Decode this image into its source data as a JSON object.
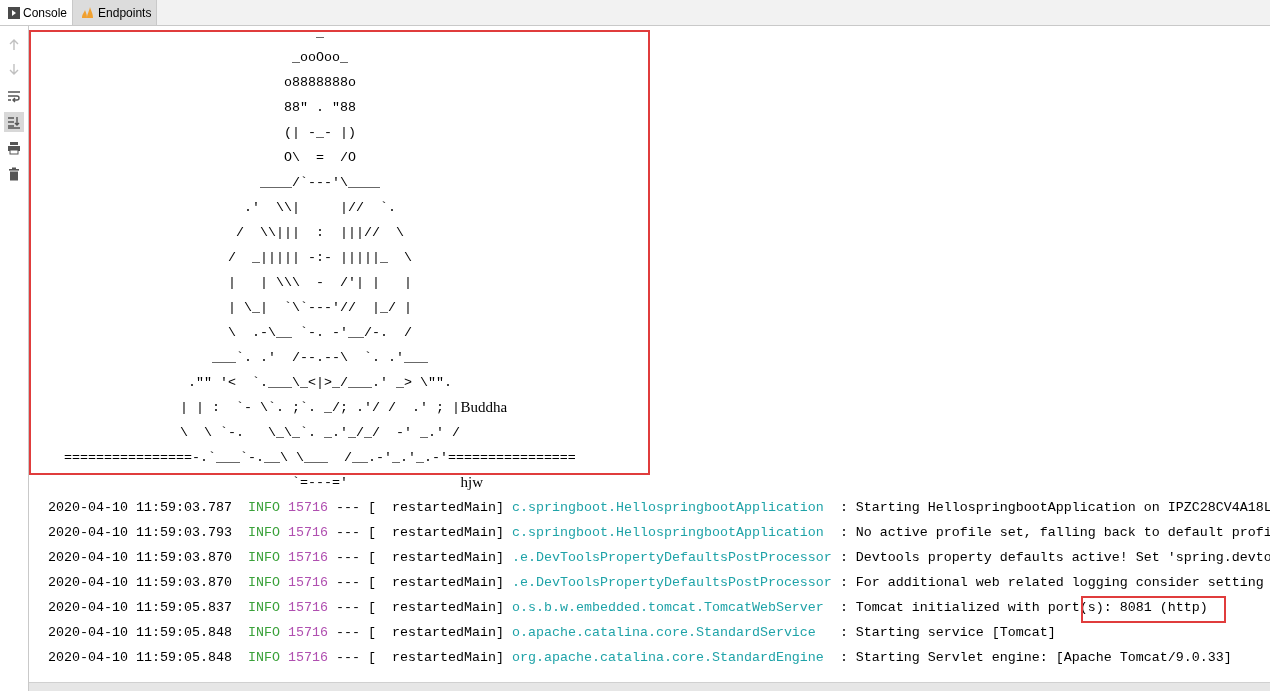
{
  "tabs": [
    {
      "label": "Console",
      "kind": "console",
      "selected": true
    },
    {
      "label": "Endpoints",
      "kind": "endpoints",
      "selected": false
    }
  ],
  "toolbar": [
    {
      "kind": "up",
      "disabled": true,
      "selected": false
    },
    {
      "kind": "down",
      "disabled": true,
      "selected": false
    },
    {
      "kind": "wrap",
      "disabled": false,
      "selected": false
    },
    {
      "kind": "scroll-end",
      "disabled": false,
      "selected": true
    },
    {
      "kind": "print",
      "disabled": false,
      "selected": false
    },
    {
      "kind": "clear",
      "disabled": false,
      "selected": false
    }
  ],
  "banner": [
    {
      "art": "_"
    },
    {
      "art": "_ooOoo_"
    },
    {
      "art": "o8888888o"
    },
    {
      "art": "88\" . \"88"
    },
    {
      "art": "(| -_- |)"
    },
    {
      "art": "O\\  =  /O"
    },
    {
      "art": "____/`---'\\____"
    },
    {
      "art": ".'  \\\\|     |//  `."
    },
    {
      "art": "/  \\\\|||  :  |||//  \\"
    },
    {
      "art": "/  _||||| -:- |||||_  \\"
    },
    {
      "art": "|   | \\\\\\  -  /'| |   |"
    },
    {
      "art": "| \\_|  `\\`---'//  |_/ |"
    },
    {
      "art": "\\  .-\\__ `-. -'__/-.  /"
    },
    {
      "art": "___`. .'  /--.--\\  `. .'___"
    },
    {
      "art": ".\"\" '<  `.___\\_<|>_/___.' _> \\\"\"."
    },
    {
      "art": "| | :  `- \\`. ;`. _/; .'/ /  .' ; |",
      "note": "Buddha"
    },
    {
      "art": "\\  \\ `-.   \\_\\_`. _.'_/_/  -' _.' /"
    },
    {
      "art": "================-.`___`-.__\\ \\___  /__.-'_.'_.-'================"
    },
    {
      "art": "`=---='",
      "note": "hjw"
    }
  ],
  "log": [
    {
      "time": "2020-04-10 11:59:03.787",
      "level": "INFO",
      "pid": "15716",
      "thread": "--- [  restartedMain]",
      "logger": "c.springboot.HellospringbootApplication",
      "message": ": Starting HellospringbootApplication on IPZC28CV4A18L"
    },
    {
      "time": "2020-04-10 11:59:03.793",
      "level": "INFO",
      "pid": "15716",
      "thread": "--- [  restartedMain]",
      "logger": "c.springboot.HellospringbootApplication",
      "message": ": No active profile set, falling back to default profi"
    },
    {
      "time": "2020-04-10 11:59:03.870",
      "level": "INFO",
      "pid": "15716",
      "thread": "--- [  restartedMain]",
      "logger": ".e.DevToolsPropertyDefaultsPostProcessor",
      "message": ": Devtools property defaults active! Set 'spring.devto"
    },
    {
      "time": "2020-04-10 11:59:03.870",
      "level": "INFO",
      "pid": "15716",
      "thread": "--- [  restartedMain]",
      "logger": ".e.DevToolsPropertyDefaultsPostProcessor",
      "message": ": For additional web related logging consider setting"
    },
    {
      "time": "2020-04-10 11:59:05.837",
      "level": "INFO",
      "pid": "15716",
      "thread": "--- [  restartedMain]",
      "logger": "o.s.b.w.embedded.tomcat.TomcatWebServer",
      "message": ": Tomcat initialized with port(s): 8081 (http)"
    },
    {
      "time": "2020-04-10 11:59:05.848",
      "level": "INFO",
      "pid": "15716",
      "thread": "--- [  restartedMain]",
      "logger": "o.apache.catalina.core.StandardService",
      "message": ": Starting service [Tomcat]"
    },
    {
      "time": "2020-04-10 11:59:05.848",
      "level": "INFO",
      "pid": "15716",
      "thread": "--- [  restartedMain]",
      "logger": "org.apache.catalina.core.StandardEngine",
      "message": ": Starting Servlet engine: [Apache Tomcat/9.0.33]"
    }
  ]
}
